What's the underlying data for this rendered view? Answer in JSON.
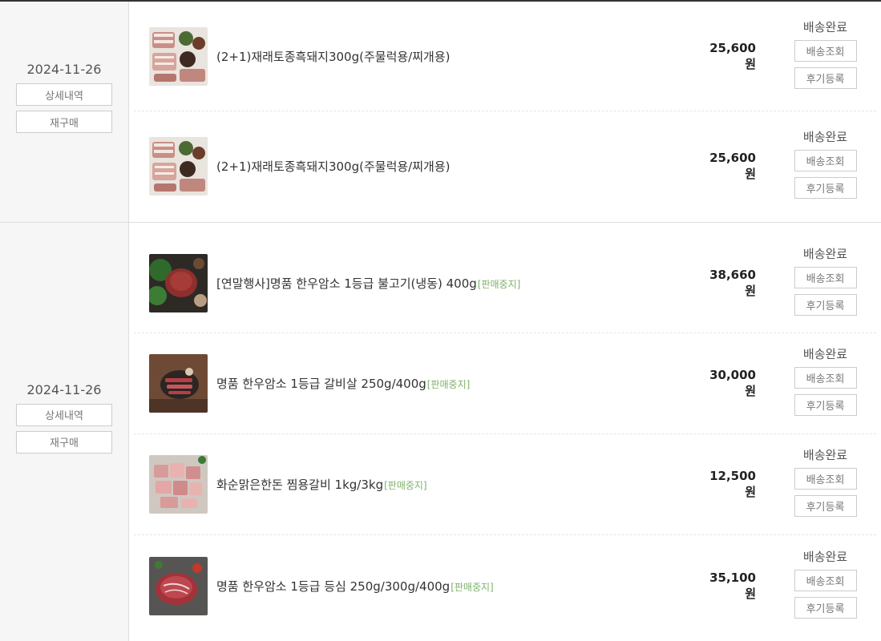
{
  "orders": [
    {
      "date": "2024-11-26",
      "detail_label": "상세내역",
      "reorder_label": "재구매",
      "items": [
        {
          "name": "(2+1)재래토종흑돼지300g(주물럭용/찌개용)",
          "tag": "",
          "price": "25,600원",
          "status": "배송완료",
          "track_label": "배송조회",
          "review_label": "후기등록",
          "thumb": "pork-platter-image"
        },
        {
          "name": "(2+1)재래토종흑돼지300g(주물럭용/찌개용)",
          "tag": "",
          "price": "25,600원",
          "status": "배송완료",
          "track_label": "배송조회",
          "review_label": "후기등록",
          "thumb": "pork-platter-image"
        }
      ]
    },
    {
      "date": "2024-11-26",
      "detail_label": "상세내역",
      "reorder_label": "재구매",
      "items": [
        {
          "name": "[연말행사]명품 한우암소 1등급 불고기(냉동) 400g",
          "tag": "[판매중지]",
          "price": "38,660원",
          "status": "배송완료",
          "track_label": "배송조회",
          "review_label": "후기등록",
          "thumb": "bulgogi-image"
        },
        {
          "name": "명품 한우암소 1등급 갈비살 250g/400g",
          "tag": "[판매중지]",
          "price": "30,000원",
          "status": "배송완료",
          "track_label": "배송조회",
          "review_label": "후기등록",
          "thumb": "galbisal-image"
        },
        {
          "name": "화순맑은한돈 찜용갈비 1kg/3kg",
          "tag": "[판매중지]",
          "price": "12,500원",
          "status": "배송완료",
          "track_label": "배송조회",
          "review_label": "후기등록",
          "thumb": "pork-ribs-image"
        },
        {
          "name": "명품 한우암소 1등급 등심 250g/300g/400g",
          "tag": "[판매중지]",
          "price": "35,100원",
          "status": "배송완료",
          "track_label": "배송조회",
          "review_label": "후기등록",
          "thumb": "sirloin-image"
        }
      ]
    }
  ]
}
